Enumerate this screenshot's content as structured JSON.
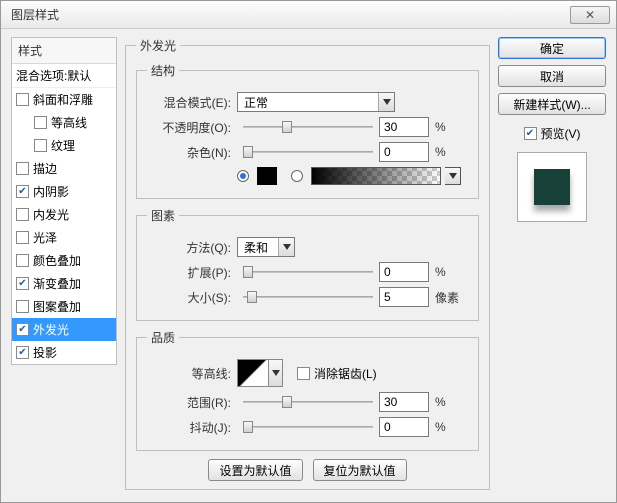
{
  "window": {
    "title": "图层样式",
    "close": "✕"
  },
  "styleList": {
    "header": "样式",
    "blend": "混合选项:默认",
    "items": {
      "bevel": "斜面和浮雕",
      "contour": "等高线",
      "texture": "纹理",
      "stroke": "描边",
      "innerShadow": "内阴影",
      "innerGlow": "内发光",
      "satin": "光泽",
      "colorOverlay": "颜色叠加",
      "gradientOverlay": "渐变叠加",
      "patternOverlay": "图案叠加",
      "outerGlow": "外发光",
      "dropShadow": "投影"
    }
  },
  "outerGlow": {
    "title": "外发光"
  },
  "structure": {
    "title": "结构",
    "blendMode": {
      "label": "混合模式(E):",
      "value": "正常"
    },
    "opacity": {
      "label": "不透明度(O):",
      "value": "30",
      "unit": "%"
    },
    "noise": {
      "label": "杂色(N):",
      "value": "0",
      "unit": "%"
    }
  },
  "element": {
    "title": "图素",
    "technique": {
      "label": "方法(Q):",
      "value": "柔和"
    },
    "spread": {
      "label": "扩展(P):",
      "value": "0",
      "unit": "%"
    },
    "size": {
      "label": "大小(S):",
      "value": "5",
      "unit": "像素"
    }
  },
  "quality": {
    "title": "品质",
    "contour": {
      "label": "等高线:"
    },
    "antiAlias": "消除锯齿(L)",
    "range": {
      "label": "范围(R):",
      "value": "30",
      "unit": "%"
    },
    "jitter": {
      "label": "抖动(J):",
      "value": "0",
      "unit": "%"
    }
  },
  "bottomBtns": {
    "setDefault": "设置为默认值",
    "resetDefault": "复位为默认值"
  },
  "rightBtns": {
    "ok": "确定",
    "cancel": "取消",
    "newStyle": "新建样式(W)...",
    "preview": "预览(V)"
  }
}
